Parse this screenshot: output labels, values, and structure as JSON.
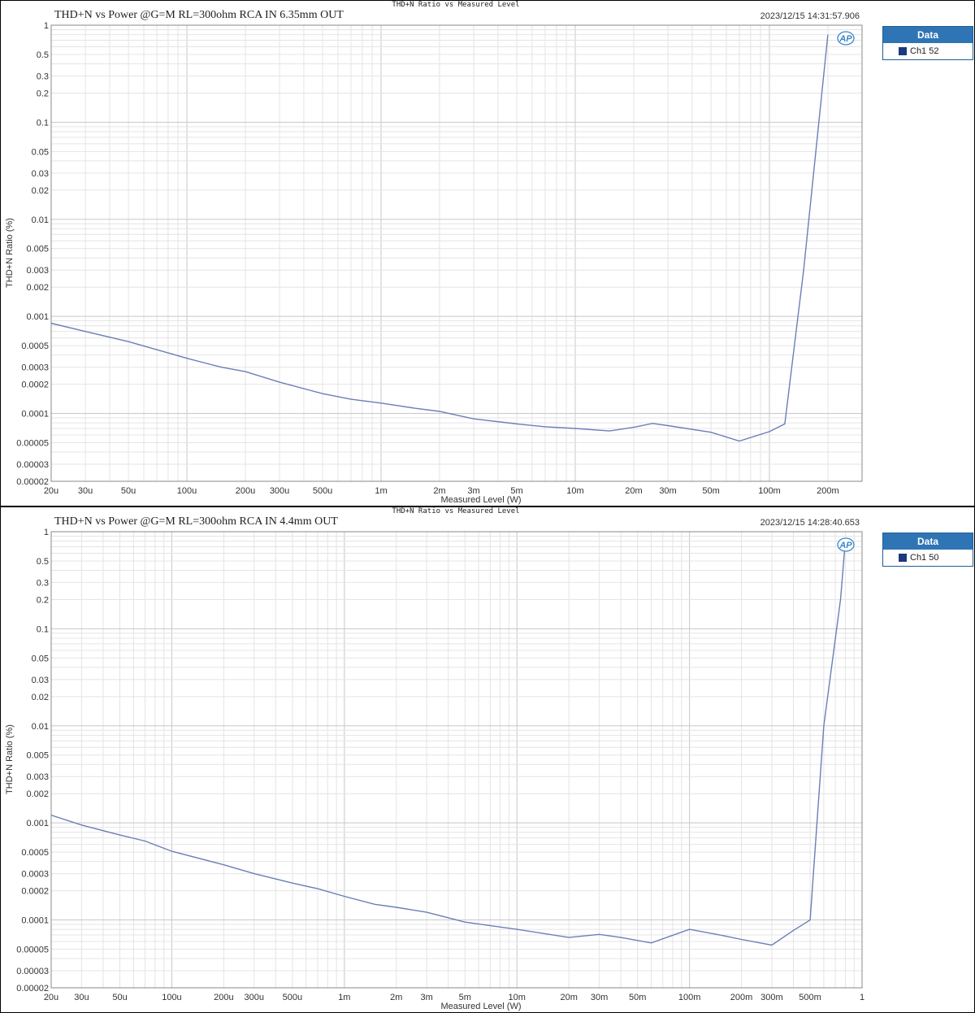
{
  "chart_data": [
    {
      "type": "line",
      "header": "THD+N Ratio vs Measured Level",
      "title": "THD+N vs Power @G=M RL=300ohm RCA IN 6.35mm OUT",
      "timestamp": "2023/12/15 14:31:57.906",
      "xlabel": "Measured Level (W)",
      "ylabel": "THD+N Ratio (%)",
      "x_scale": "log",
      "y_scale": "log",
      "xlim": [
        2e-05,
        0.3
      ],
      "ylim": [
        2e-05,
        1
      ],
      "grid": true,
      "legend": {
        "title": "Data",
        "placement": "right",
        "entries": [
          "Ch1 52"
        ]
      },
      "line_color": "#6a7fb5",
      "x_ticks": [
        "20u",
        "30u",
        "50u",
        "100u",
        "200u",
        "300u",
        "500u",
        "1m",
        "2m",
        "3m",
        "5m",
        "10m",
        "20m",
        "30m",
        "50m",
        "100m",
        "200m"
      ],
      "y_ticks": [
        "1",
        "0.5",
        "0.3",
        "0.2",
        "0.1",
        "0.05",
        "0.03",
        "0.02",
        "0.01",
        "0.005",
        "0.003",
        "0.002",
        "0.001",
        "0.0005",
        "0.0003",
        "0.0002",
        "0.0001",
        "0.00005",
        "0.00003",
        "0.00002"
      ],
      "series": [
        {
          "name": "Ch1 52",
          "x": [
            2e-05,
            3e-05,
            5e-05,
            8e-05,
            0.0001,
            0.00015,
            0.0002,
            0.0003,
            0.0005,
            0.0007,
            0.001,
            0.0015,
            0.002,
            0.003,
            0.005,
            0.007,
            0.01,
            0.015,
            0.02,
            0.025,
            0.03,
            0.05,
            0.07,
            0.1,
            0.12,
            0.15,
            0.2
          ],
          "y": [
            0.00085,
            0.0007,
            0.00055,
            0.00042,
            0.00037,
            0.0003,
            0.00027,
            0.00021,
            0.00016,
            0.00014,
            0.000128,
            0.000113,
            0.000105,
            8.8e-05,
            7.8e-05,
            7.3e-05,
            7e-05,
            6.6e-05,
            7.2e-05,
            7.9e-05,
            7.5e-05,
            6.4e-05,
            5.2e-05,
            6.5e-05,
            7.8e-05,
            0.003,
            0.8
          ]
        }
      ]
    },
    {
      "type": "line",
      "header": "THD+N Ratio vs Measured Level",
      "title": "THD+N vs Power @G=M RL=300ohm RCA IN 4.4mm OUT",
      "timestamp": "2023/12/15 14:28:40.653",
      "xlabel": "Measured Level (W)",
      "ylabel": "THD+N Ratio (%)",
      "x_scale": "log",
      "y_scale": "log",
      "xlim": [
        2e-05,
        1
      ],
      "ylim": [
        2e-05,
        1
      ],
      "grid": true,
      "legend": {
        "title": "Data",
        "placement": "right",
        "entries": [
          "Ch1 50"
        ]
      },
      "line_color": "#6a7fb5",
      "x_ticks": [
        "20u",
        "30u",
        "50u",
        "100u",
        "200u",
        "300u",
        "500u",
        "1m",
        "2m",
        "3m",
        "5m",
        "10m",
        "20m",
        "30m",
        "50m",
        "100m",
        "200m",
        "300m",
        "500m",
        "1"
      ],
      "y_ticks": [
        "1",
        "0.5",
        "0.3",
        "0.2",
        "0.1",
        "0.05",
        "0.03",
        "0.02",
        "0.01",
        "0.005",
        "0.003",
        "0.002",
        "0.001",
        "0.0005",
        "0.0003",
        "0.0002",
        "0.0001",
        "0.00005",
        "0.00003",
        "0.00002"
      ],
      "series": [
        {
          "name": "Ch1 50",
          "x": [
            2e-05,
            3e-05,
            5e-05,
            7e-05,
            0.0001,
            0.0002,
            0.0003,
            0.0005,
            0.0007,
            0.001,
            0.0015,
            0.002,
            0.003,
            0.005,
            0.01,
            0.02,
            0.03,
            0.04,
            0.06,
            0.1,
            0.15,
            0.2,
            0.3,
            0.4,
            0.5,
            0.6,
            0.75,
            0.8
          ],
          "y": [
            0.0012,
            0.00095,
            0.00075,
            0.00065,
            0.00051,
            0.00037,
            0.0003,
            0.00024,
            0.00021,
            0.000175,
            0.000145,
            0.000135,
            0.00012,
            9.5e-05,
            8e-05,
            6.6e-05,
            7.1e-05,
            6.6e-05,
            5.8e-05,
            8e-05,
            7e-05,
            6.3e-05,
            5.5e-05,
            7.8e-05,
            0.0001,
            0.01,
            0.2,
            0.8
          ]
        }
      ]
    }
  ]
}
